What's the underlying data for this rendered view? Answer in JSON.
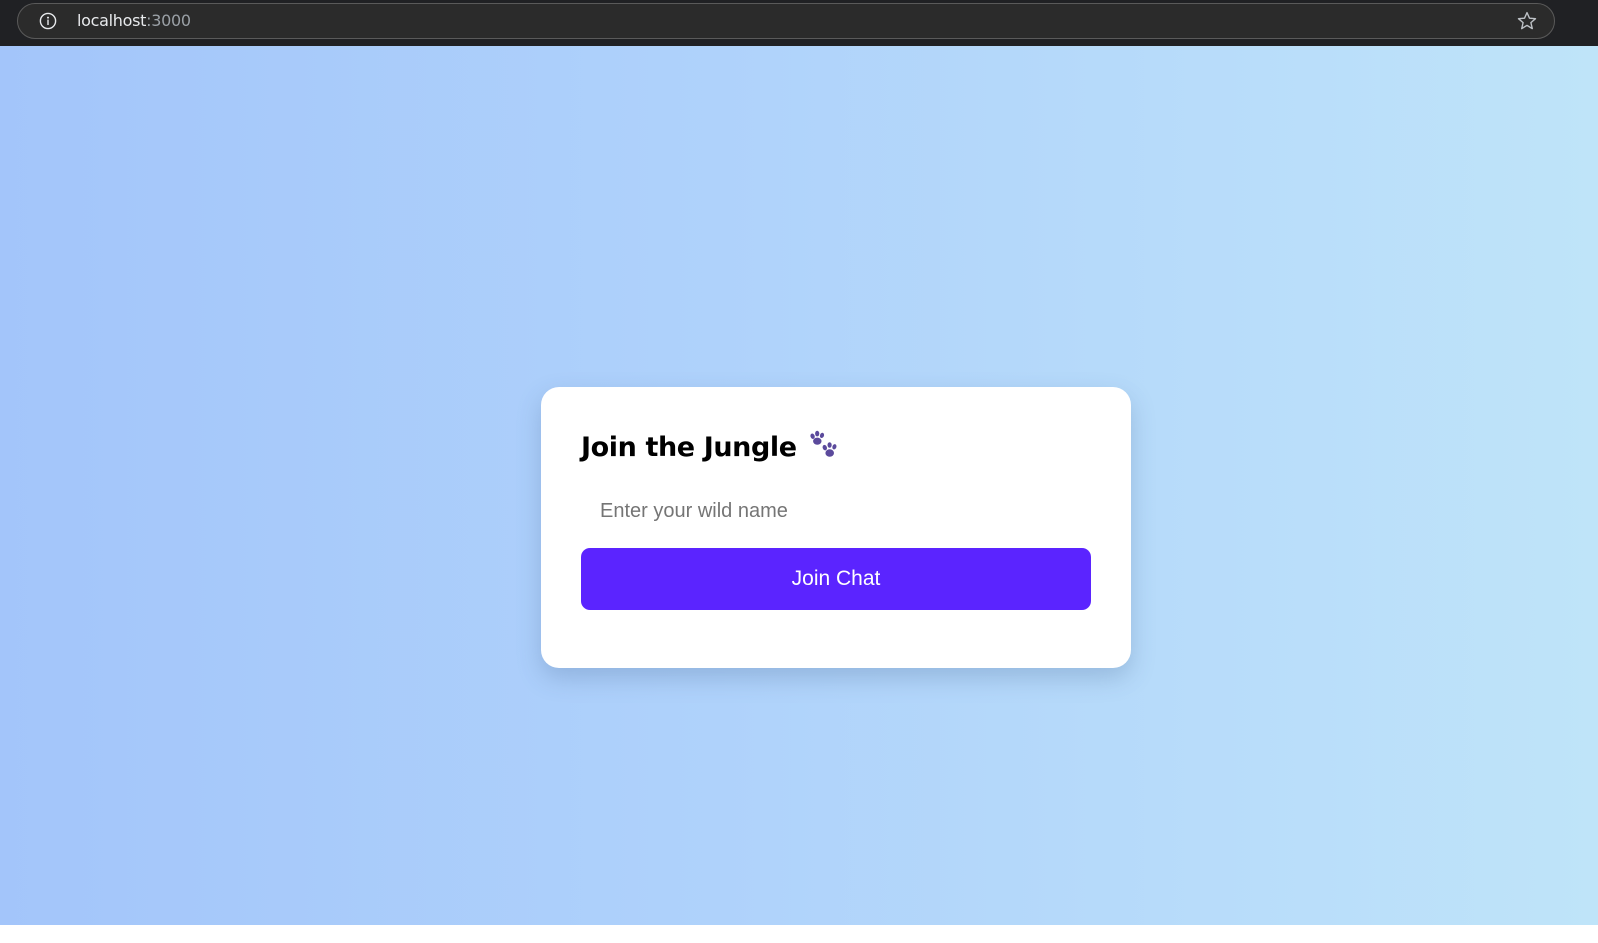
{
  "browser": {
    "url_host": "localhost",
    "url_port": ":3000",
    "info_icon": "info-icon",
    "bookmark_icon": "star-icon"
  },
  "page": {
    "background_gradient": [
      "#a3c5fa",
      "#afd2fb",
      "#bfe4f9"
    ]
  },
  "login_card": {
    "title": "Join the Jungle",
    "title_icon": "paw-prints-icon",
    "title_icon_color": "#5b4a9c",
    "name_input": {
      "placeholder": "Enter your wild name",
      "value": ""
    },
    "join_button": {
      "label": "Join Chat",
      "color": "#5b24ff"
    }
  }
}
